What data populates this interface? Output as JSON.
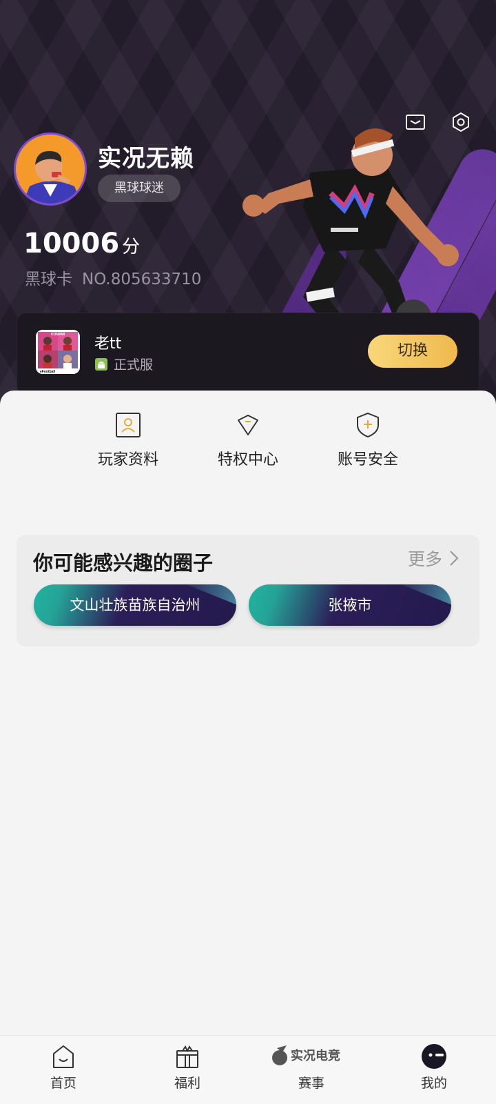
{
  "profile": {
    "username": "实况无赖",
    "rank": "黑球球迷",
    "score": "10006",
    "score_unit": "分",
    "card_label": "黑球卡",
    "card_number": "NO.805633710"
  },
  "account": {
    "game_name": "老tt",
    "server": "正式服",
    "switch_label": "切换",
    "game_icon_text": [
      "KONAMI",
      "eFootball"
    ]
  },
  "quick_actions": [
    {
      "label": "玩家资料",
      "icon": "person-card-icon"
    },
    {
      "label": "特权中心",
      "icon": "diamond-icon"
    },
    {
      "label": "账号安全",
      "icon": "shield-plus-icon"
    }
  ],
  "circles": {
    "title": "你可能感兴趣的圈子",
    "more_label": "更多",
    "items": [
      "文山壮族苗族自治州",
      "张掖市"
    ]
  },
  "nav": [
    {
      "label": "首页",
      "icon": "home-icon"
    },
    {
      "label": "福利",
      "icon": "gift-icon"
    },
    {
      "label": "赛事",
      "icon": "esports-logo-icon",
      "logo_text": "实况电竞"
    },
    {
      "label": "我的",
      "icon": "profile-face-icon"
    }
  ],
  "colors": {
    "header_bg": "#2a2233",
    "accent_purple": "#7d4bd0",
    "switch_gold": "#efb94e",
    "chip_teal": "#1fb4a0",
    "chip_navy": "#241a4d"
  }
}
